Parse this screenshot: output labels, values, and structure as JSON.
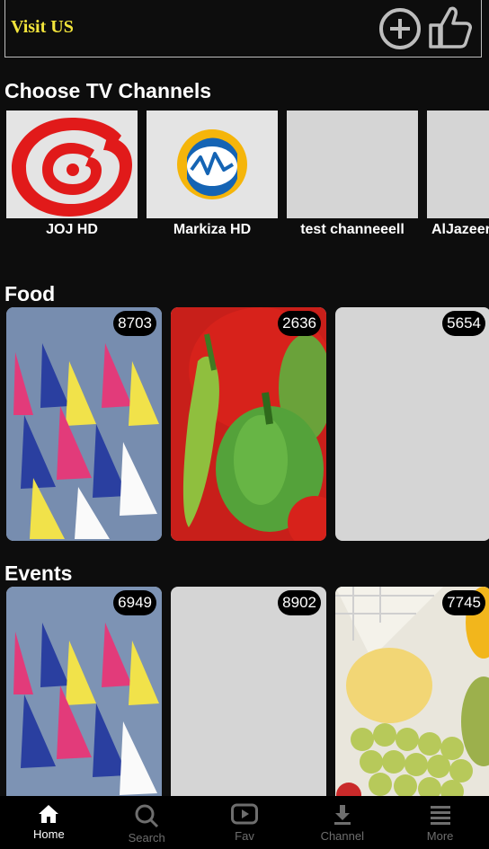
{
  "header": {
    "visit_label": "Visit US",
    "add_icon": "plus-circle-icon",
    "like_icon": "thumbs-up-icon",
    "visit_color": "#f2e43b"
  },
  "channels": {
    "title": "Choose TV Channels",
    "items": [
      {
        "name": "JOJ HD"
      },
      {
        "name": "Markiza HD"
      },
      {
        "name": "test channeeell"
      },
      {
        "name": "AlJazeera"
      }
    ]
  },
  "food": {
    "title": "Food",
    "items": [
      {
        "count": "8703"
      },
      {
        "count": "2636"
      },
      {
        "count": "5654"
      }
    ]
  },
  "events": {
    "title": "Events",
    "items": [
      {
        "count": "6949"
      },
      {
        "count": "8902"
      },
      {
        "count": "7745"
      }
    ]
  },
  "nav": {
    "items": [
      {
        "label": "Home",
        "icon": "home-icon"
      },
      {
        "label": "Search",
        "icon": "search-icon"
      },
      {
        "label": "Fav",
        "icon": "play-icon"
      },
      {
        "label": "Channel",
        "icon": "download-icon"
      },
      {
        "label": "More",
        "icon": "menu-icon"
      }
    ]
  }
}
